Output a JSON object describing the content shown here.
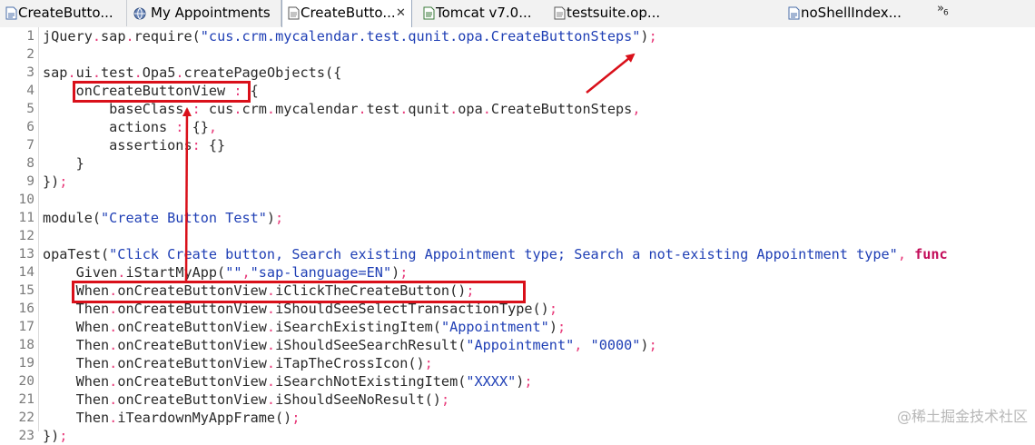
{
  "tabs": [
    {
      "label": "CreateButto...",
      "icon": "html-file-icon",
      "active": false
    },
    {
      "label": "My Appointments",
      "icon": "globe-icon",
      "active": false
    },
    {
      "label": "CreateButto...",
      "icon": "js-file-icon",
      "active": true,
      "close": "✕"
    },
    {
      "label": "Tomcat v7.0...",
      "icon": "server-icon",
      "active": false
    },
    {
      "label": "testsuite.op...",
      "icon": "js-file-icon",
      "active": false
    },
    {
      "label": "noShellIndex...",
      "icon": "html-file-icon",
      "active": false
    }
  ],
  "overflow": {
    "symbol": "»",
    "count": "6"
  },
  "editor": {
    "line_numbers": [
      "1",
      "2",
      "3",
      "4",
      "5",
      "6",
      "7",
      "8",
      "9",
      "10",
      "11",
      "12",
      "13",
      "14",
      "15",
      "16",
      "17",
      "18",
      "19",
      "20",
      "21",
      "22",
      "23"
    ],
    "lines": [
      [
        [
          "t",
          "jQuery"
        ],
        [
          "p",
          "."
        ],
        [
          "t",
          "sap"
        ],
        [
          "p",
          "."
        ],
        [
          "t",
          "require("
        ],
        [
          "s",
          "\"cus.crm.mycalendar.test.qunit.opa.CreateButtonSteps\""
        ],
        [
          "t",
          ")"
        ],
        [
          "p",
          ";"
        ]
      ],
      [],
      [
        [
          "t",
          "sap"
        ],
        [
          "p",
          "."
        ],
        [
          "t",
          "ui"
        ],
        [
          "p",
          "."
        ],
        [
          "t",
          "test"
        ],
        [
          "p",
          "."
        ],
        [
          "t",
          "Opa5"
        ],
        [
          "p",
          "."
        ],
        [
          "t",
          "createPageObjects({"
        ]
      ],
      [
        [
          "t",
          "    onCreateButtonView"
        ],
        [
          "p",
          " : "
        ],
        [
          "t",
          "{"
        ]
      ],
      [
        [
          "t",
          "        baseClass"
        ],
        [
          "p",
          " : "
        ],
        [
          "t",
          "cus"
        ],
        [
          "p",
          "."
        ],
        [
          "t",
          "crm"
        ],
        [
          "p",
          "."
        ],
        [
          "t",
          "mycalendar"
        ],
        [
          "p",
          "."
        ],
        [
          "t",
          "test"
        ],
        [
          "p",
          "."
        ],
        [
          "t",
          "qunit"
        ],
        [
          "p",
          "."
        ],
        [
          "t",
          "opa"
        ],
        [
          "p",
          "."
        ],
        [
          "t",
          "CreateButtonSteps"
        ],
        [
          "p",
          ","
        ]
      ],
      [
        [
          "t",
          "        actions"
        ],
        [
          "p",
          " : "
        ],
        [
          "t",
          "{}"
        ],
        [
          "p",
          ","
        ]
      ],
      [
        [
          "t",
          "        assertions"
        ],
        [
          "p",
          ": "
        ],
        [
          "t",
          "{}"
        ]
      ],
      [
        [
          "t",
          "    }"
        ]
      ],
      [
        [
          "t",
          "})"
        ],
        [
          "p",
          ";"
        ]
      ],
      [],
      [
        [
          "t",
          "module("
        ],
        [
          "s",
          "\"Create Button Test\""
        ],
        [
          "t",
          ")"
        ],
        [
          "p",
          ";"
        ]
      ],
      [],
      [
        [
          "t",
          "opaTest("
        ],
        [
          "s",
          "\"Click Create button, Search existing Appointment type; Search a not-existing Appointment type\""
        ],
        [
          "p",
          ", "
        ],
        [
          "k",
          "func"
        ]
      ],
      [
        [
          "t",
          "    Given"
        ],
        [
          "p",
          "."
        ],
        [
          "t",
          "iStartMyApp("
        ],
        [
          "s",
          "\"\""
        ],
        [
          "p",
          ","
        ],
        [
          "s",
          "\"sap-language=EN\""
        ],
        [
          "t",
          ")"
        ],
        [
          "p",
          ";"
        ]
      ],
      [
        [
          "t",
          "    When"
        ],
        [
          "p",
          "."
        ],
        [
          "t",
          "onCreateButtonView"
        ],
        [
          "p",
          "."
        ],
        [
          "t",
          "iClickTheCreateButton()"
        ],
        [
          "p",
          ";"
        ]
      ],
      [
        [
          "t",
          "    Then"
        ],
        [
          "p",
          "."
        ],
        [
          "t",
          "onCreateButtonView"
        ],
        [
          "p",
          "."
        ],
        [
          "t",
          "iShouldSeeSelectTransactionType()"
        ],
        [
          "p",
          ";"
        ]
      ],
      [
        [
          "t",
          "    When"
        ],
        [
          "p",
          "."
        ],
        [
          "t",
          "onCreateButtonView"
        ],
        [
          "p",
          "."
        ],
        [
          "t",
          "iSearchExistingItem("
        ],
        [
          "s",
          "\"Appointment\""
        ],
        [
          "t",
          ")"
        ],
        [
          "p",
          ";"
        ]
      ],
      [
        [
          "t",
          "    Then"
        ],
        [
          "p",
          "."
        ],
        [
          "t",
          "onCreateButtonView"
        ],
        [
          "p",
          "."
        ],
        [
          "t",
          "iShouldSeeSearchResult("
        ],
        [
          "s",
          "\"Appointment\""
        ],
        [
          "p",
          ", "
        ],
        [
          "s",
          "\"0000\""
        ],
        [
          "t",
          ")"
        ],
        [
          "p",
          ";"
        ]
      ],
      [
        [
          "t",
          "    Then"
        ],
        [
          "p",
          "."
        ],
        [
          "t",
          "onCreateButtonView"
        ],
        [
          "p",
          "."
        ],
        [
          "t",
          "iTapTheCrossIcon()"
        ],
        [
          "p",
          ";"
        ]
      ],
      [
        [
          "t",
          "    When"
        ],
        [
          "p",
          "."
        ],
        [
          "t",
          "onCreateButtonView"
        ],
        [
          "p",
          "."
        ],
        [
          "t",
          "iSearchNotExistingItem("
        ],
        [
          "s",
          "\"XXXX\""
        ],
        [
          "t",
          ")"
        ],
        [
          "p",
          ";"
        ]
      ],
      [
        [
          "t",
          "    Then"
        ],
        [
          "p",
          "."
        ],
        [
          "t",
          "onCreateButtonView"
        ],
        [
          "p",
          "."
        ],
        [
          "t",
          "iShouldSeeNoResult()"
        ],
        [
          "p",
          ";"
        ]
      ],
      [
        [
          "t",
          "    Then"
        ],
        [
          "p",
          "."
        ],
        [
          "t",
          "iTeardownMyAppFrame()"
        ],
        [
          "p",
          ";"
        ]
      ],
      [
        [
          "t",
          "})"
        ],
        [
          "p",
          ";"
        ]
      ]
    ]
  },
  "annotation_color": "#d9101a",
  "watermark": "@稀土掘金技术社区"
}
